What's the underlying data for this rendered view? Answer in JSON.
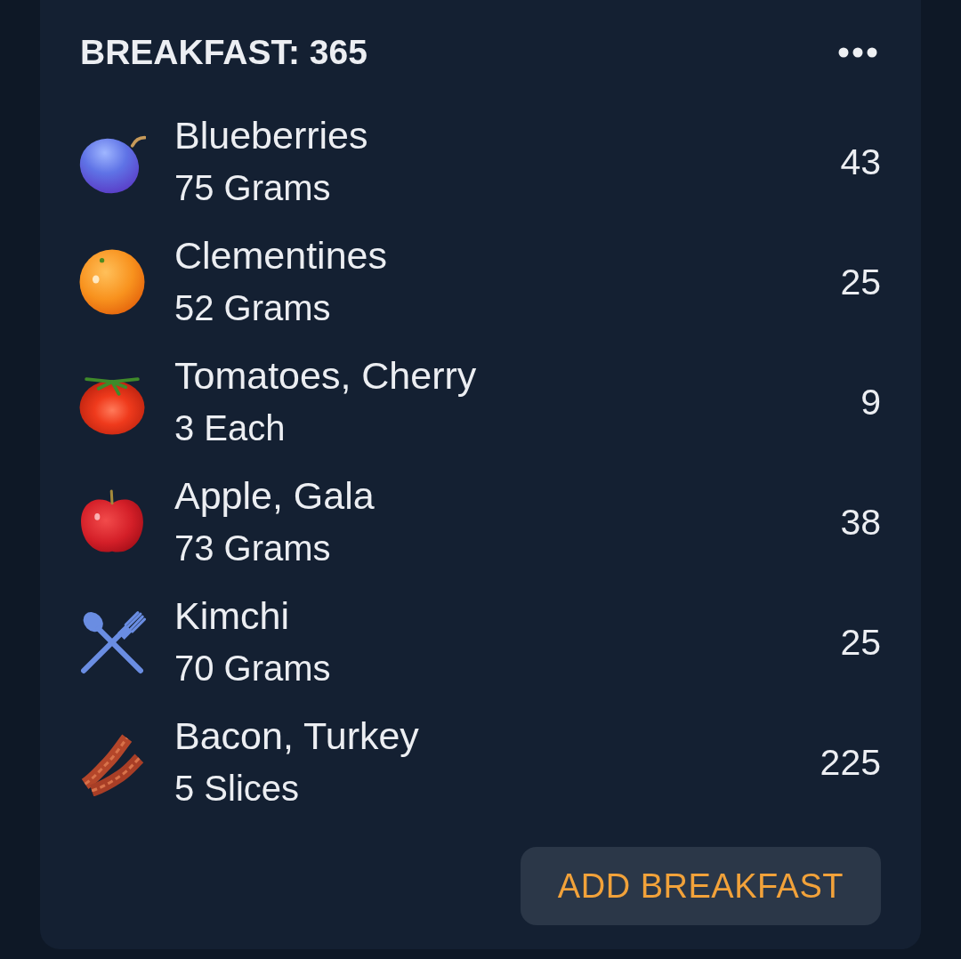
{
  "meal": {
    "title": "BREAKFAST: 365"
  },
  "items": [
    {
      "kind": "blueberry",
      "name": "Blueberries",
      "serving": "75 Grams",
      "calories": "43"
    },
    {
      "kind": "clementine",
      "name": "Clementines",
      "serving": "52 Grams",
      "calories": "25"
    },
    {
      "kind": "tomato",
      "name": "Tomatoes, Cherry",
      "serving": "3 Each",
      "calories": "9"
    },
    {
      "kind": "apple",
      "name": "Apple, Gala",
      "serving": "73 Grams",
      "calories": "38"
    },
    {
      "kind": "generic",
      "name": "Kimchi",
      "serving": "70 Grams",
      "calories": "25"
    },
    {
      "kind": "bacon",
      "name": "Bacon, Turkey",
      "serving": "5 Slices",
      "calories": "225"
    }
  ],
  "add_button": {
    "label": "ADD BREAKFAST"
  }
}
